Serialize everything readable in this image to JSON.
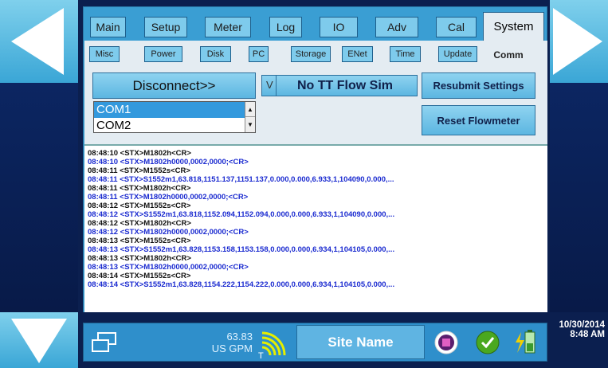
{
  "tabs": [
    "Main",
    "Setup",
    "Meter",
    "Log",
    "IO",
    "Adv",
    "Cal",
    "System"
  ],
  "active_tab": "System",
  "subtabs": [
    "Misc",
    "Power",
    "Disk",
    "PC",
    "Storage",
    "ENet",
    "Time",
    "Update",
    "Comm"
  ],
  "active_subtab": "Comm",
  "controls": {
    "disconnect_label": "Disconnect>>",
    "check_mark": "V",
    "flow_sim_label": "No TT Flow Sim",
    "resubmit_label": "Resubmit Settings",
    "reset_label": "Reset Flowmeter",
    "com_ports": [
      "COM1",
      "COM2"
    ],
    "selected_port": "COM1"
  },
  "log": [
    {
      "text": "08:48:10 <STX>M1802h<CR>",
      "kind": "tx"
    },
    {
      "text": "08:48:10 <STX>M1802h0000,0002,0000;<CR>",
      "kind": "rx"
    },
    {
      "text": "08:48:11 <STX>M1552s<CR>",
      "kind": "tx"
    },
    {
      "text": "08:48:11 <STX>S1552m1,63.818,1151.137,1151.137,0.000,0.000,6.933,1,104090,0.000,...",
      "kind": "rx"
    },
    {
      "text": "08:48:11 <STX>M1802h<CR>",
      "kind": "tx"
    },
    {
      "text": "08:48:11 <STX>M1802h0000,0002,0000;<CR>",
      "kind": "rx"
    },
    {
      "text": "08:48:12 <STX>M1552s<CR>",
      "kind": "tx"
    },
    {
      "text": "08:48:12 <STX>S1552m1,63.818,1152.094,1152.094,0.000,0.000,6.933,1,104090,0.000,...",
      "kind": "rx"
    },
    {
      "text": "08:48:12 <STX>M1802h<CR>",
      "kind": "tx"
    },
    {
      "text": "08:48:12 <STX>M1802h0000,0002,0000;<CR>",
      "kind": "rx"
    },
    {
      "text": "08:48:13 <STX>M1552s<CR>",
      "kind": "tx"
    },
    {
      "text": "08:48:13 <STX>S1552m1,63.828,1153.158,1153.158,0.000,0.000,6.934,1,104105,0.000,...",
      "kind": "rx"
    },
    {
      "text": "08:48:13 <STX>M1802h<CR>",
      "kind": "tx"
    },
    {
      "text": "08:48:13 <STX>M1802h0000,0002,0000;<CR>",
      "kind": "rx"
    },
    {
      "text": "08:48:14 <STX>M1552s<CR>",
      "kind": "tx"
    },
    {
      "text": "08:48:14 <STX>S1552m1,63.828,1154.222,1154.222,0.000,0.000,6.934,1,104105,0.000,...",
      "kind": "rx"
    }
  ],
  "status": {
    "flow_value": "63.83",
    "flow_unit": "US GPM",
    "signal_label": "T",
    "site_name": "Site Name",
    "date": "10/30/2014",
    "time": "8:48 AM"
  },
  "colors": {
    "accent": "#3a9ed3",
    "panel_bg": "#e4ecf2",
    "log_tx": "#111111",
    "log_rx": "#1a2ad0",
    "ok_green": "#4aa820",
    "stop_purple": "#a0218a"
  },
  "icons": [
    "left-arrow-icon",
    "right-arrow-icon",
    "down-arrow-icon",
    "window-switch-icon",
    "signal-strength-icon",
    "stop-record-icon",
    "ok-check-icon",
    "battery-power-icon"
  ]
}
